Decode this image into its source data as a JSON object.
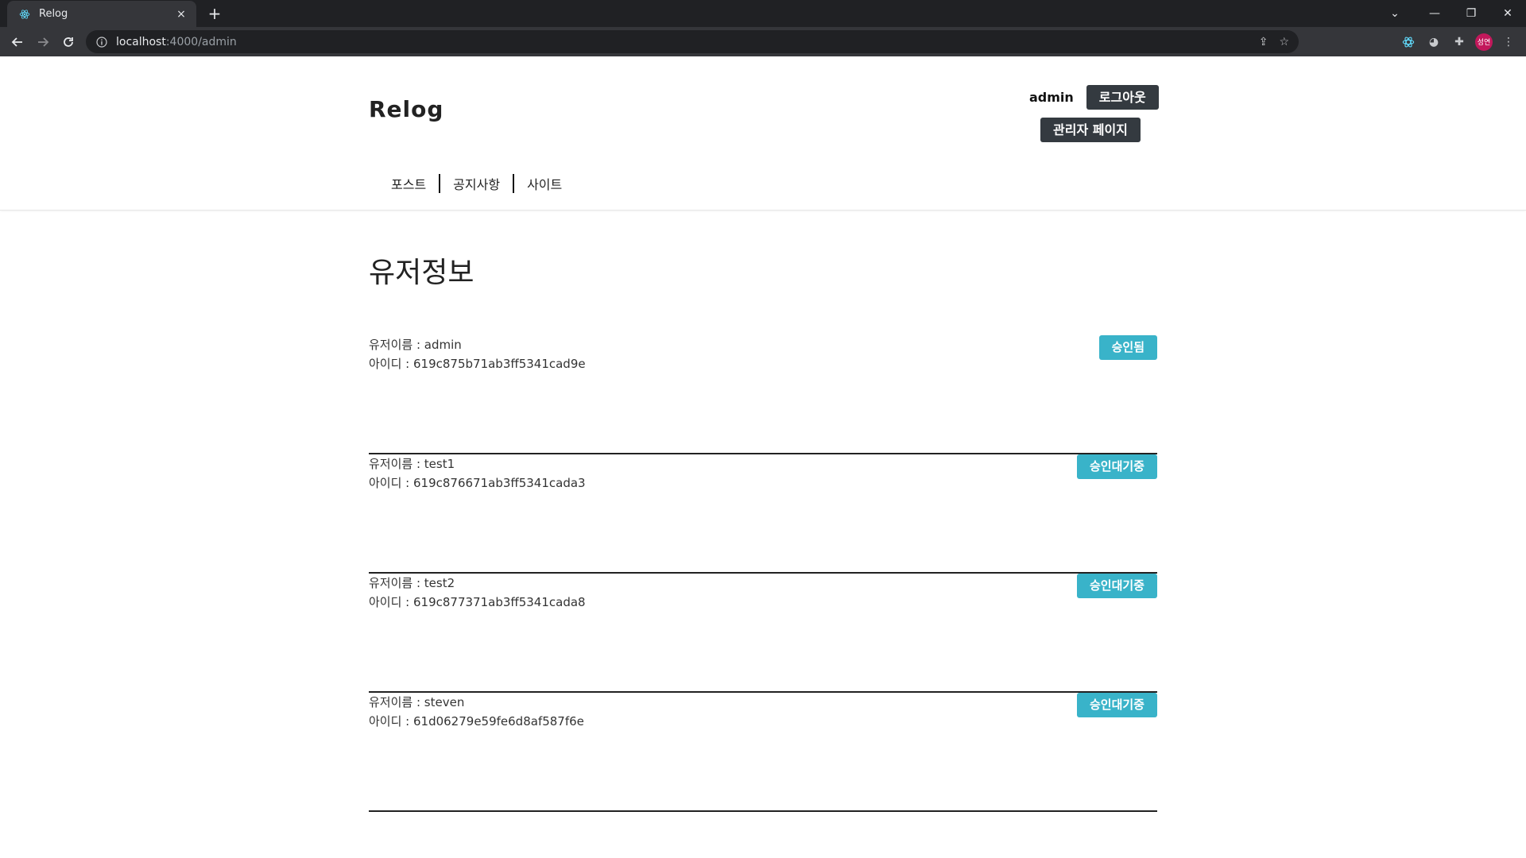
{
  "browser": {
    "tab_title": "Relog",
    "tab_close": "×",
    "new_tab": "+",
    "url_host": "localhost",
    "url_path": ":4000/admin",
    "profile_label": "성연"
  },
  "header": {
    "logo": "Relog",
    "username": "admin",
    "logout_label": "로그아웃",
    "admin_page_label": "관리자 페이지",
    "menu": [
      {
        "label": "포스트"
      },
      {
        "label": "공지사항"
      },
      {
        "label": "사이트"
      }
    ]
  },
  "main": {
    "title": "유저정보",
    "users": [
      {
        "name_line": "유저이름 : admin",
        "id_line": "아이디 : 619c875b71ab3ff5341cad9e",
        "status": "승인됨"
      },
      {
        "name_line": "유저이름 : test1",
        "id_line": "아이디 : 619c876671ab3ff5341cada3",
        "status": "승인대기중"
      },
      {
        "name_line": "유저이름 : test2",
        "id_line": "아이디 : 619c877371ab3ff5341cada8",
        "status": "승인대기중"
      },
      {
        "name_line": "유저이름 : steven",
        "id_line": "아이디 : 61d06279e59fe6d8af587f6e",
        "status": "승인대기중"
      }
    ]
  },
  "colors": {
    "status_button": "#39b3c9",
    "dark_button": "#343a40"
  }
}
